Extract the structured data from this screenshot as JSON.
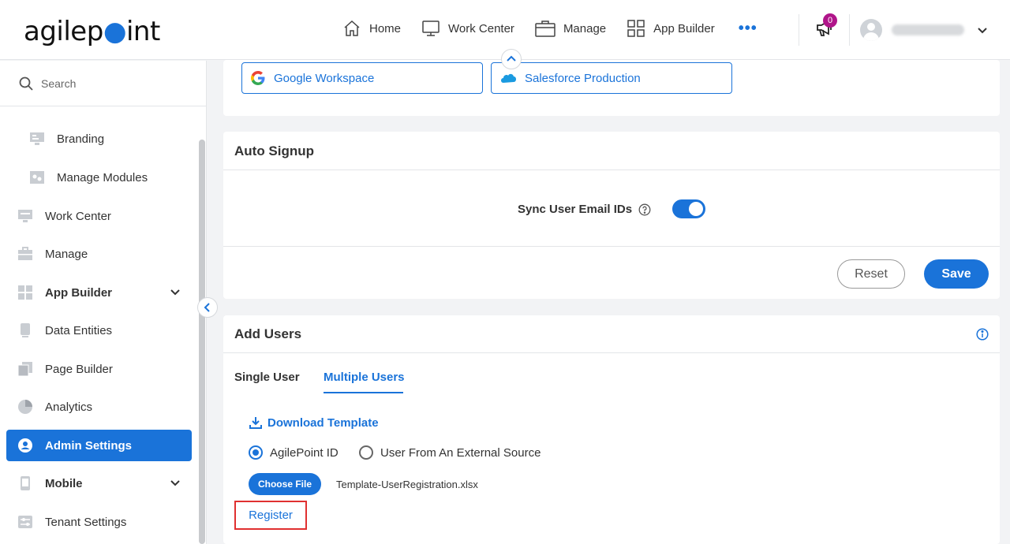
{
  "header": {
    "logo_text_a": "agilep",
    "logo_text_b": "int",
    "nav": [
      {
        "label": "Home",
        "icon": "home-icon"
      },
      {
        "label": "Work Center",
        "icon": "monitor-icon"
      },
      {
        "label": "Manage",
        "icon": "briefcase-icon"
      },
      {
        "label": "App Builder",
        "icon": "grid-icon"
      }
    ],
    "more": "•••",
    "notifications_count": "0"
  },
  "sidebar": {
    "search_placeholder": "Search",
    "items": [
      {
        "label": "Branding",
        "icon": "branding-icon"
      },
      {
        "label": "Manage Modules",
        "icon": "modules-icon"
      },
      {
        "label": "Work Center",
        "icon": "monitor-icon"
      },
      {
        "label": "Manage",
        "icon": "briefcase-icon"
      },
      {
        "label": "App Builder",
        "icon": "grid-icon"
      },
      {
        "label": "Data Entities",
        "icon": "database-icon"
      },
      {
        "label": "Page Builder",
        "icon": "pages-icon"
      },
      {
        "label": "Analytics",
        "icon": "pie-chart-icon"
      },
      {
        "label": "Admin Settings",
        "icon": "admin-icon"
      },
      {
        "label": "Mobile",
        "icon": "mobile-icon"
      },
      {
        "label": "Tenant Settings",
        "icon": "sliders-icon"
      }
    ]
  },
  "sso": {
    "google": "Google Workspace",
    "salesforce": "Salesforce Production"
  },
  "auto_signup": {
    "title": "Auto Signup",
    "sync_label": "Sync User Email IDs",
    "sync_enabled": true,
    "reset_label": "Reset",
    "save_label": "Save"
  },
  "add_users": {
    "title": "Add Users",
    "tabs": [
      "Single User",
      "Multiple Users"
    ],
    "active_tab": "Multiple Users",
    "download_label": "Download Template",
    "radio_options": [
      "AgilePoint ID",
      "User From An External Source"
    ],
    "selected_option": "AgilePoint ID",
    "choose_file_label": "Choose File",
    "file_name": "Template-UserRegistration.xlsx",
    "register_label": "Register"
  },
  "colors": {
    "accent": "#1a73d9",
    "highlight": "#e03030",
    "badge": "#b0158a"
  }
}
